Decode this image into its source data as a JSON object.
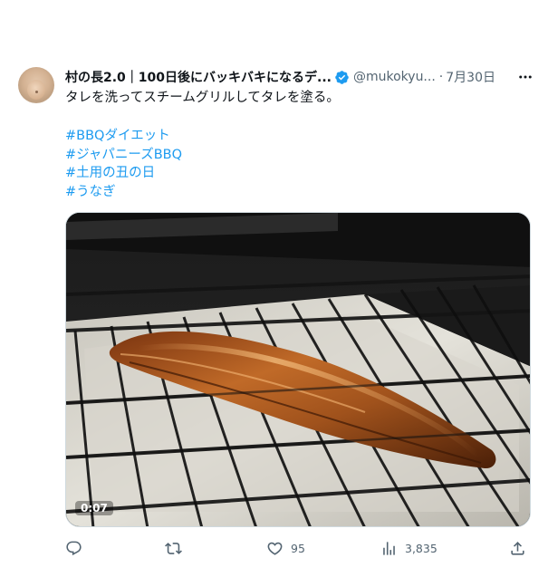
{
  "tweet": {
    "author_name": "村の長2.0｜100日後にバッキバキになるデ...",
    "handle": "@mukokyu...",
    "separator": "·",
    "date": "7月30日",
    "text": "タレを洗ってスチームグリルしてタレを塗る。",
    "hashtags": [
      "#BBQダイエット",
      "#ジャパニーズBBQ",
      "#土用の丑の日",
      "#うなぎ"
    ]
  },
  "media": {
    "timestamp": "0:07"
  },
  "actions": {
    "reply_count": "",
    "retweet_count": "",
    "like_count": "95",
    "views_count": "3,835"
  },
  "colors": {
    "text": "#0f1419",
    "secondary": "#536471",
    "link": "#1d9bf0",
    "verified": "#1d9bf0"
  }
}
